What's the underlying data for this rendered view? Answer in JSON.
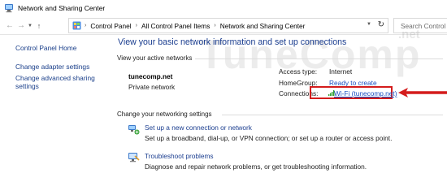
{
  "window": {
    "title": "Network and Sharing Center"
  },
  "address_bar": {
    "breadcrumbs": [
      "Control Panel",
      "All Control Panel Items",
      "Network and Sharing Center"
    ],
    "search_placeholder": "Search Control Panel"
  },
  "sidebar": {
    "items": [
      {
        "label": "Control Panel Home"
      },
      {
        "label": "Change adapter settings"
      },
      {
        "label": "Change advanced sharing"
      },
      {
        "label": "settings"
      }
    ]
  },
  "main": {
    "heading": "View your basic network information and set up connections",
    "active_networks_label": "View your active networks",
    "network": {
      "name": "tunecomp.net",
      "category": "Private network",
      "access_type_label": "Access type:",
      "access_type_value": "Internet",
      "homegroup_label": "HomeGroup:",
      "homegroup_value": "Ready to create",
      "connections_label": "Connections:",
      "connections_value": "Wi-Fi (tunecomp.net)"
    },
    "change_settings_label": "Change your networking settings",
    "tasks": [
      {
        "title": "Set up a new connection or network",
        "description": "Set up a broadband, dial-up, or VPN connection; or set up a router or access point."
      },
      {
        "title": "Troubleshoot problems",
        "description": "Diagnose and repair network problems, or get troubleshooting information."
      }
    ]
  },
  "watermark": {
    "text": "TuneComp",
    "suffix": ".net"
  },
  "colors": {
    "link": "#1a4fc2",
    "heading": "#1a3d8f",
    "highlight_box": "#d41c1c"
  }
}
